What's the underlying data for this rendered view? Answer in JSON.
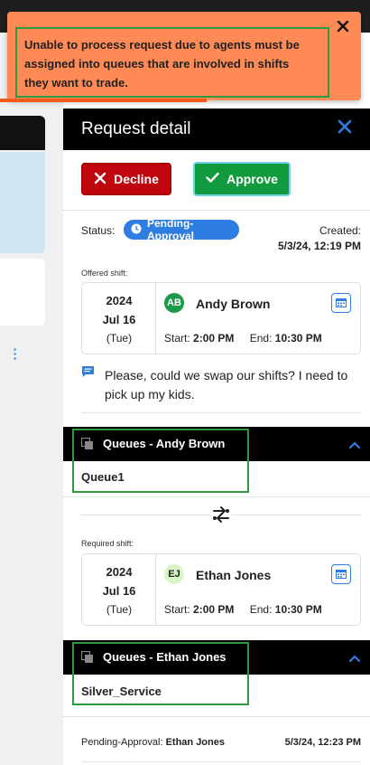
{
  "toast": {
    "message": "Unable to process request due to agents must be assigned into queues that are involved in shifts they want to trade.",
    "progress": 0.58
  },
  "panel": {
    "title": "Request detail",
    "decline_label": "Decline",
    "approve_label": "Approve",
    "status_label": "Status:",
    "status_value": "Pending-Approval",
    "created_label": "Created:",
    "created_value": "5/3/24, 12:19 PM"
  },
  "offered": {
    "section_label": "Offered shift:",
    "year": "2024",
    "day": "Jul 16",
    "dow": "(Tue)",
    "avatar": "AB",
    "name": "Andy Brown",
    "start_label": "Start:",
    "start": "2:00 PM",
    "end_label": "End:",
    "end": "10:30 PM"
  },
  "message": "Please, could we swap our shifts? I need to pick up my kids.",
  "queues_andy": {
    "title": "Queues - Andy Brown",
    "items": [
      "Queue1"
    ]
  },
  "required": {
    "section_label": "Required shift:",
    "year": "2024",
    "day": "Jul 16",
    "dow": "(Tue)",
    "avatar": "EJ",
    "name": "Ethan Jones",
    "start_label": "Start:",
    "start": "2:00 PM",
    "end_label": "End:",
    "end": "10:30 PM"
  },
  "queues_ethan": {
    "title": "Queues - Ethan Jones",
    "items": [
      "Silver_Service"
    ]
  },
  "history": {
    "status": "Pending-Approval:",
    "name": "Ethan Jones",
    "time": "5/3/24, 12:23 PM"
  },
  "colors": {
    "toast_bg": "#ff8a56",
    "decline": "#c0050f",
    "approve": "#129a3e",
    "status_badge": "#2e7de0"
  },
  "icons": [
    "close-icon",
    "check-icon",
    "clock-icon",
    "calendar-icon",
    "message-icon",
    "queue-icon",
    "chevron-up-icon",
    "swap-icon",
    "kebab-icon"
  ]
}
